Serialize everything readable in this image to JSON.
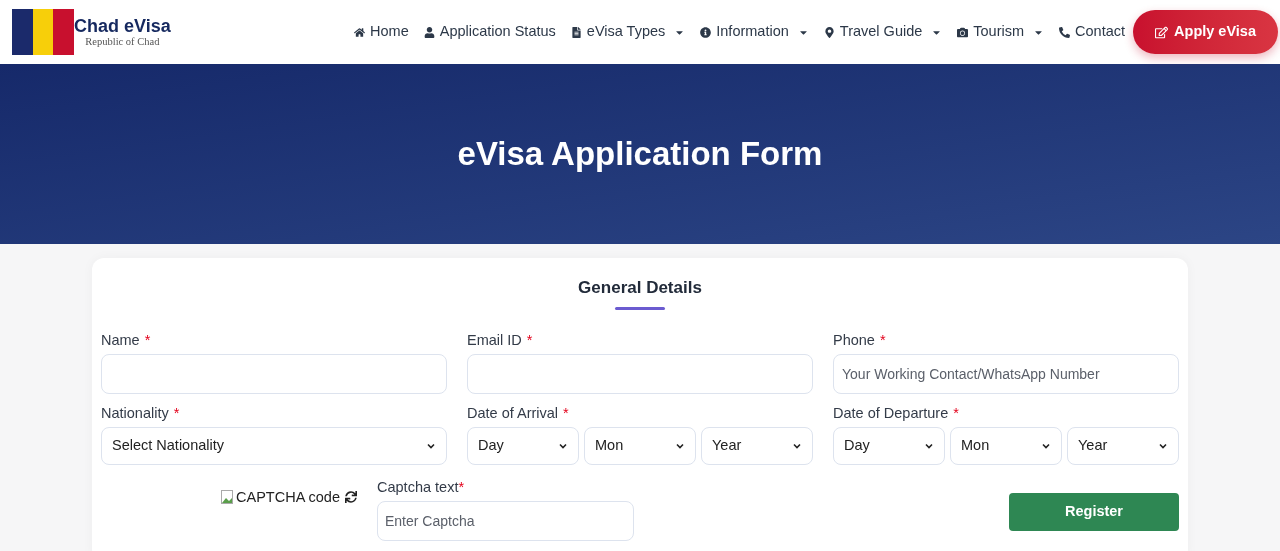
{
  "brand": {
    "title": "Chad eVisa",
    "subtitle": "Republic of Chad"
  },
  "nav": [
    {
      "label": "Home",
      "dropdown": false
    },
    {
      "label": "Application Status",
      "dropdown": false
    },
    {
      "label": "eVisa Types",
      "dropdown": true
    },
    {
      "label": "Information",
      "dropdown": true
    },
    {
      "label": "Travel Guide",
      "dropdown": true
    },
    {
      "label": "Tourism",
      "dropdown": true
    },
    {
      "label": "Contact",
      "dropdown": false
    }
  ],
  "apply_button": "Apply eVisa",
  "hero": {
    "title": "eVisa Application Form"
  },
  "form": {
    "title": "General Details",
    "fields": [
      {
        "label": "Name",
        "mark": "*",
        "kind": "input"
      },
      {
        "label": "Email ID",
        "mark": "*",
        "kind": "input"
      },
      {
        "label": "Phone",
        "mark": "*",
        "kind": "input",
        "placeholder": "Your Working Contact/WhatsApp Number"
      },
      {
        "label": "Nationality",
        "mark": "*",
        "kind": "select",
        "values": [
          "Select Nationality"
        ]
      },
      {
        "label": "Date of Arrival",
        "mark": "*",
        "kind": "select",
        "values": [
          "Day",
          "Mon",
          "Year"
        ]
      },
      {
        "label": "Date of Departure",
        "mark": "*",
        "kind": "select",
        "values": [
          "Day",
          "Mon",
          "Year"
        ]
      }
    ],
    "captcha_image": "CAPTCHA code",
    "captcha": {
      "label": "Captcha text",
      "mark": "*",
      "placeholder": "Enter Captcha"
    },
    "submit": "Register"
  }
}
